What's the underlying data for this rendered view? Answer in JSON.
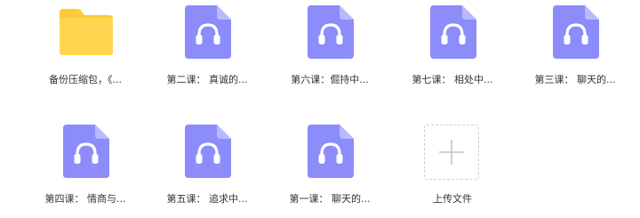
{
  "files": [
    {
      "name": "备份压缩包，《...",
      "icon": "folder-icon"
    },
    {
      "name": "第二课：  真诚的...",
      "icon": "audio-file-icon"
    },
    {
      "name": "第六课：倔持中...",
      "icon": "audio-file-icon"
    },
    {
      "name": "第七课：  相处中...",
      "icon": "audio-file-icon"
    },
    {
      "name": "第三课：  聊天的...",
      "icon": "audio-file-icon"
    },
    {
      "name": "第四课：  情商与...",
      "icon": "audio-file-icon"
    },
    {
      "name": "第五课：  追求中...",
      "icon": "audio-file-icon"
    },
    {
      "name": "第一课：  聊天的...",
      "icon": "audio-file-icon"
    }
  ],
  "upload": {
    "label": "上传文件",
    "icon": "plus-icon"
  },
  "colors": {
    "folder": "#FFD24D",
    "folder_tab": "#F5C02E",
    "audio_file": "#8C8CFA",
    "audio_fold": "#B9B9FF",
    "text": "#333333"
  }
}
